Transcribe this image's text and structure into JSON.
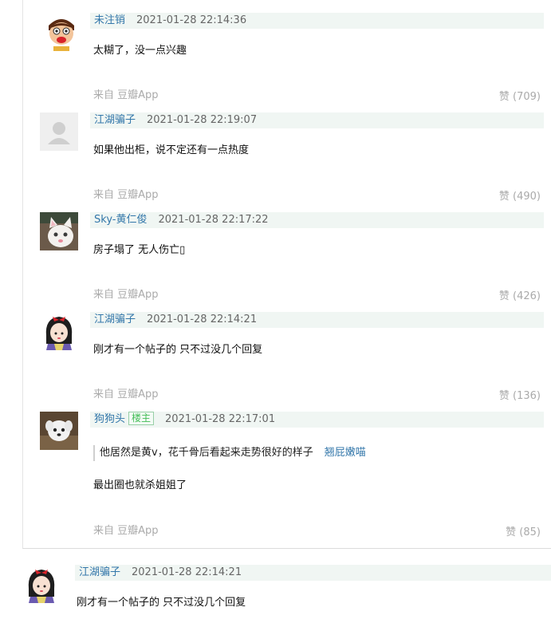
{
  "replies": [
    {
      "author": "未注销",
      "time": "2021-01-28 22:14:36",
      "text": "太糊了，没一点兴趣",
      "source": "来自 豆瓣App",
      "like": "赞 (709)",
      "avatar_icon": "cartoon-boy-avatar"
    },
    {
      "author": "江湖骗子",
      "time": "2021-01-28 22:19:07",
      "text": "如果他出柜，说不定还有一点热度",
      "source": "来自 豆瓣App",
      "like": "赞 (490)",
      "avatar_icon": "default-user-avatar"
    },
    {
      "author": "Sky-黄仁俊",
      "time": "2021-01-28 22:17:22",
      "text": "房子塌了 无人伤亡▯",
      "source": "来自 豆瓣App",
      "like": "赞 (426)",
      "avatar_icon": "white-cat-avatar"
    },
    {
      "author": "江湖骗子",
      "time": "2021-01-28 22:14:21",
      "text": "刚才有一个帖子的 只不过没几个回复",
      "source": "来自 豆瓣App",
      "like": "赞 (136)",
      "avatar_icon": "snow-white-avatar"
    },
    {
      "author": "狗狗头",
      "badge": "楼主",
      "time": "2021-01-28 22:17:01",
      "quote_text": "他居然是黄v，花千骨后看起来走势很好的样子",
      "quote_author": "翘屁嫩喵",
      "text": "最出圈也就杀姐姐了",
      "source": "来自 豆瓣App",
      "like": "赞 (85)",
      "avatar_icon": "white-dog-avatar"
    }
  ],
  "main_comment": {
    "author": "江湖骗子",
    "time": "2021-01-28 22:14:21",
    "text": "刚才有一个帖子的 只不过没几个回复",
    "avatar_icon": "snow-white-avatar"
  },
  "colors": {
    "link": "#3377aa",
    "meta_bg": "#f0f6f3",
    "muted": "#aaaaaa",
    "badge_green": "#42bd56"
  }
}
